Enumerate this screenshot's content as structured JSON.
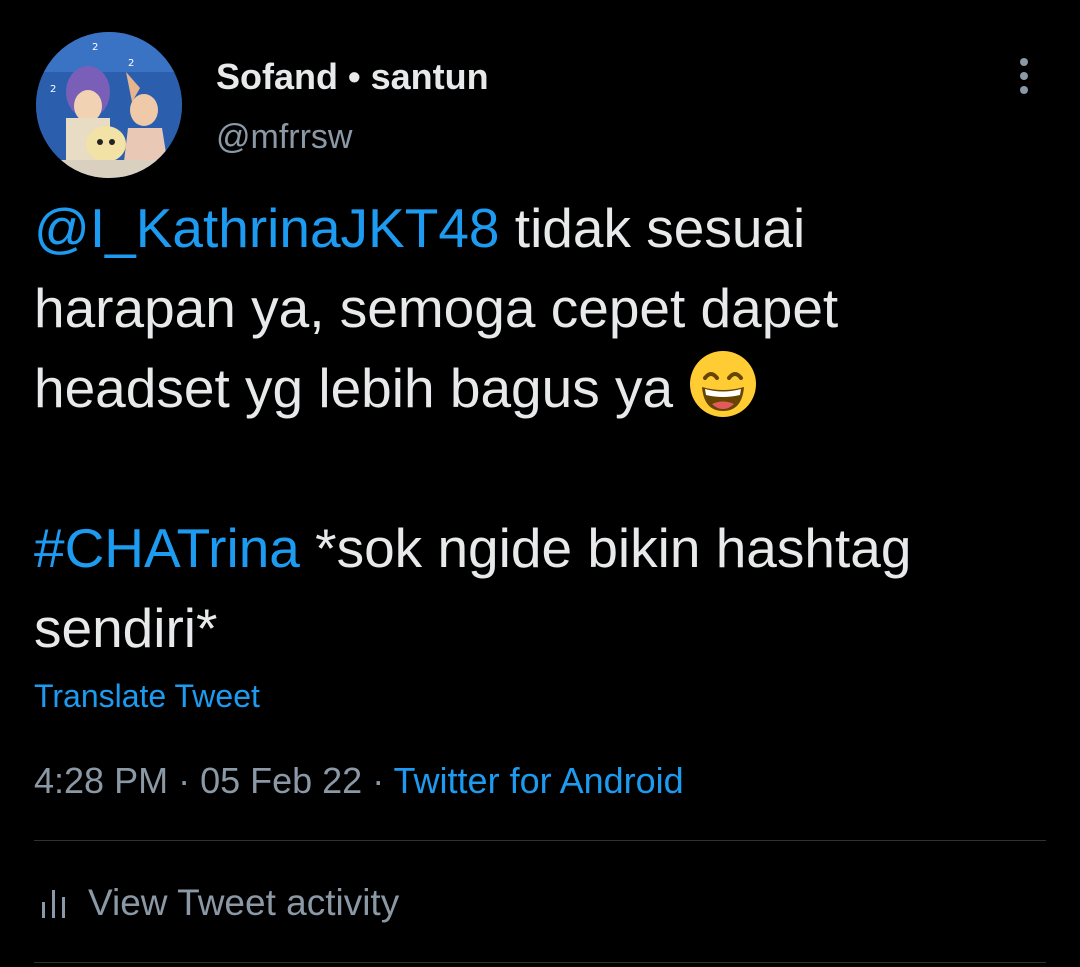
{
  "tweet": {
    "author": {
      "display_name": "Sofand • santun",
      "handle": "@mfrrsw",
      "avatar_icon": "profile-avatar"
    },
    "more_icon": "more-vertical-icon",
    "text": {
      "mention": "@I_KathrinaJKT48",
      "line1_rest": " tidak sesuai",
      "line2": "harapan ya, semoga cepet dapet",
      "line3": "headset yg lebih bagus ya ",
      "emoji": "grinning-face-with-smiling-eyes",
      "hashtag": "#CHATrina",
      "line4_rest": " *sok ngide bikin hashtag",
      "line5": "sendiri*"
    },
    "translate_label": "Translate Tweet",
    "time": "4:28 PM",
    "separator": " · ",
    "date": "05 Feb 22",
    "source": "Twitter for Android",
    "activity_label": "View Tweet activity",
    "activity_icon": "bar-chart-icon"
  },
  "colors": {
    "background": "#000000",
    "text": "#e7e9ea",
    "secondary": "#8b98a5",
    "link": "#1d9bf0",
    "divider": "#2f3336"
  }
}
